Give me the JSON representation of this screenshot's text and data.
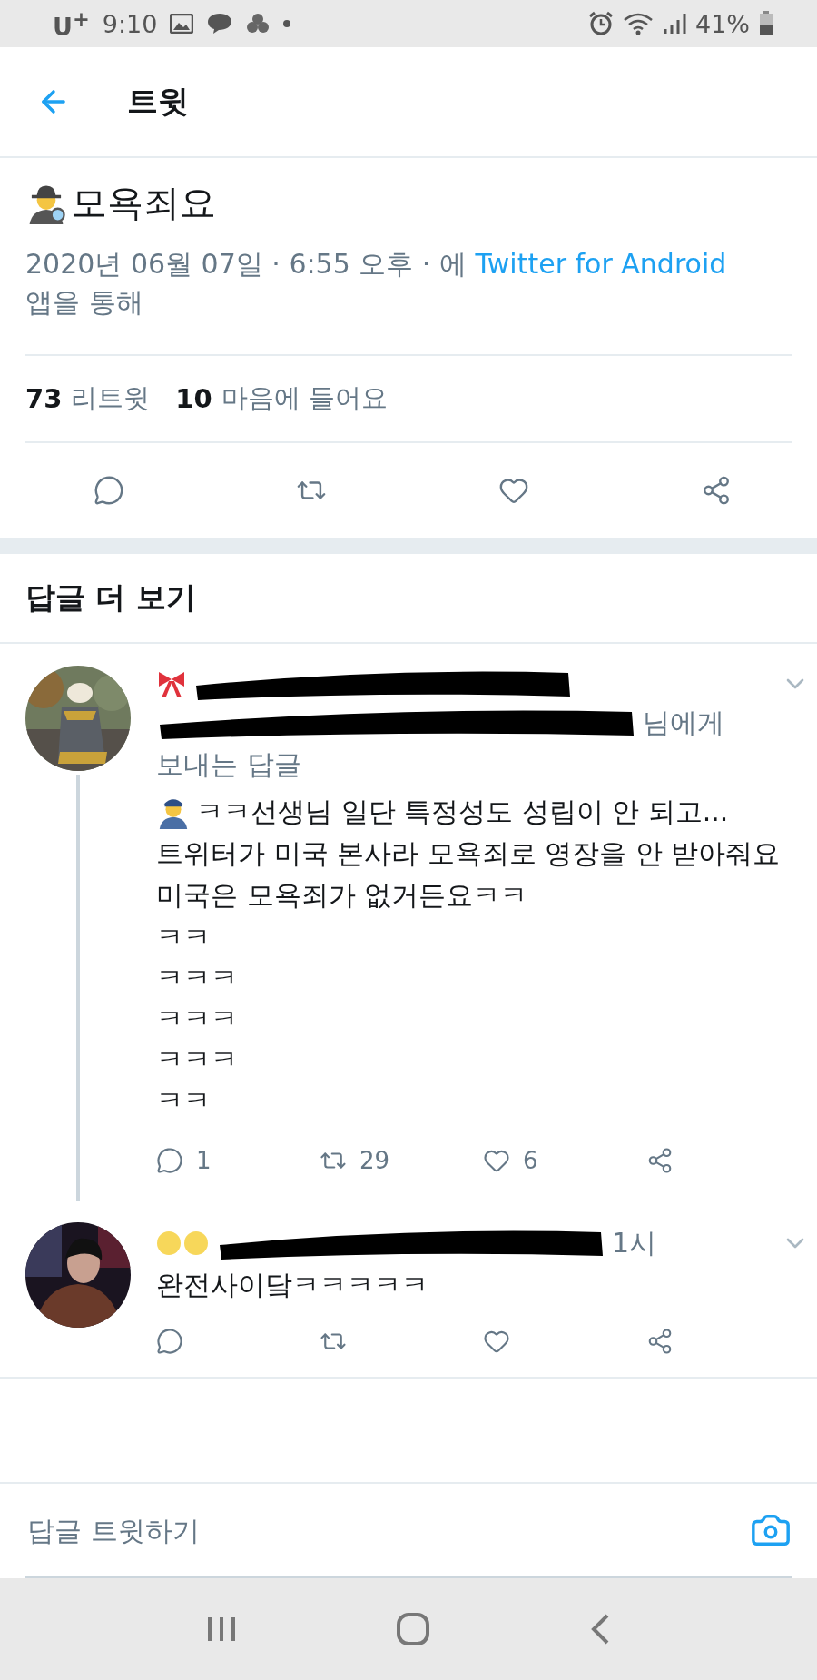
{
  "status_bar": {
    "carrier": "U$^{+}$",
    "time": "9:10",
    "battery": "41%"
  },
  "header": {
    "title": "트윗"
  },
  "tweet": {
    "text": "모욕죄요",
    "meta_prefix": "2020년 06월 07일 · 6:55 오후 · 에",
    "source": "Twitter for Android",
    "meta_suffix": "앱을 통해",
    "stats": [
      {
        "count": "73",
        "label": "리트윗"
      },
      {
        "count": "10",
        "label": "마음에 들어요"
      }
    ]
  },
  "replies_heading": "답글 더 보기",
  "replies": [
    {
      "kind": "reply_to",
      "reply_to_suffix": "님에게",
      "reply_to_line2": "보내는 답글",
      "lines": [
        "ㅋㅋ선생님 일단 특정성도 성립이 안 되고...",
        "트위터가 미국 본사라 모욕죄로 영장을 안 받아줘요",
        "미국은 모욕죄가 없거든요ㅋㅋ",
        "ㅋㅋ",
        "ㅋㅋㅋ",
        "ㅋㅋㅋ",
        "ㅋㅋㅋ",
        "ㅋㅋ"
      ],
      "counts": [
        "1",
        "29",
        "6"
      ],
      "thread_line": true
    },
    {
      "kind": "plain",
      "time": "1시",
      "lines": [
        "완전사이닼ㅋㅋㅋㅋㅋ"
      ],
      "thread_line": false
    }
  ],
  "compose": {
    "placeholder": "답글 트윗하기"
  }
}
